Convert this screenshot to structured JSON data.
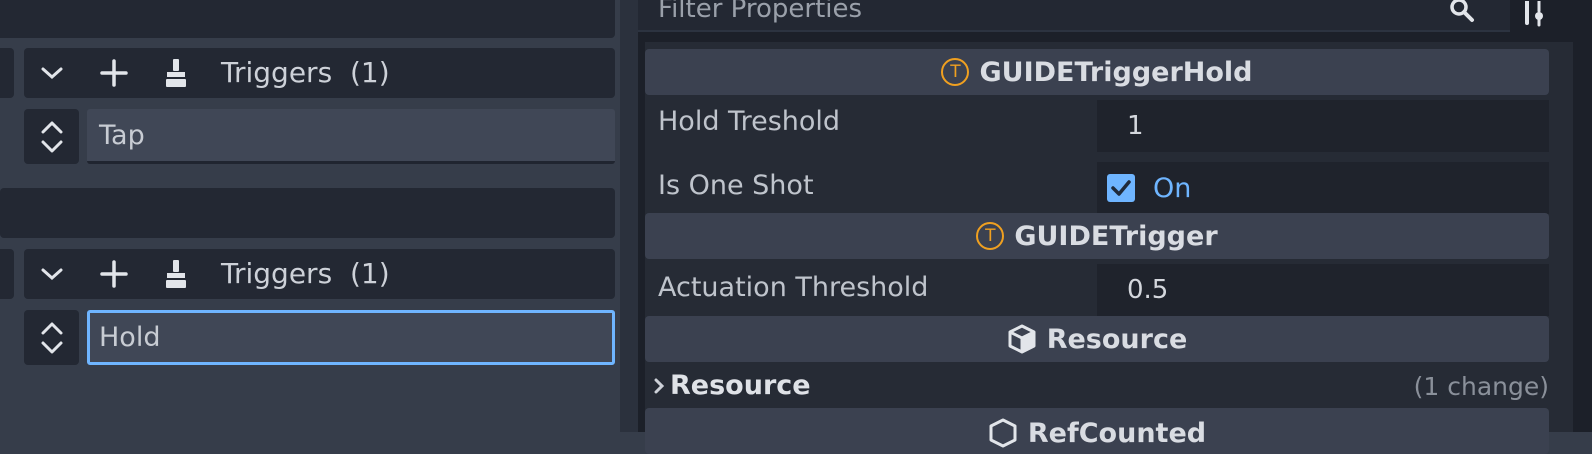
{
  "left_panel": {
    "triggers_rows": [
      {
        "label": "Triggers",
        "count": "(1)",
        "option_value": "Tap"
      },
      {
        "label": "Triggers",
        "count": "(1)",
        "option_value": "Hold"
      }
    ],
    "icons": {
      "collapse": "chevron-down-icon",
      "add": "plus-icon",
      "clear": "broom-icon",
      "spinner": "up-down-arrows-icon"
    }
  },
  "inspector": {
    "filter_placeholder": "Filter Properties",
    "sections": [
      {
        "title": "GUIDETriggerHold",
        "icon": "trigger-T-icon",
        "properties": [
          {
            "label": "Hold Treshold",
            "value": "1"
          },
          {
            "label": "Is One Shot",
            "value": "On",
            "checked": true
          }
        ]
      },
      {
        "title": "GUIDETrigger",
        "icon": "trigger-T-icon",
        "properties": [
          {
            "label": "Actuation Threshold",
            "value": "0.5"
          }
        ]
      },
      {
        "title": "Resource",
        "icon": "cube-icon",
        "subsection": {
          "label": "Resource",
          "changes": "(1 change)"
        }
      }
    ],
    "bottom_partial_header": "RefCounted"
  },
  "colors": {
    "accent_blue": "#6fb5ff",
    "trigger_orange": "#f0a020",
    "panel_bg": "#363d4a",
    "field_bg": "#404756"
  }
}
